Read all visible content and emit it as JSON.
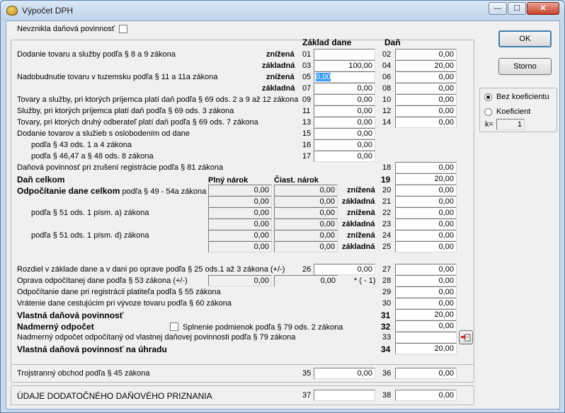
{
  "window": {
    "title": "Výpočet DPH",
    "min": "—",
    "max": "☐",
    "close": "✕"
  },
  "top": {
    "nevznikla": "Nevznikla daňová povinnosť",
    "hdr_zaklad": "Základ dane",
    "hdr_dan": "Daň"
  },
  "buttons": {
    "ok": "OK",
    "storno": "Storno"
  },
  "koef": {
    "bez": "Bez koeficientu",
    "koef": "Koeficient",
    "k_label": "k=",
    "k_value": "1"
  },
  "rows": {
    "r1": "Dodanie tovaru a služby podľa § 8 a 9 zákona",
    "znizena": "znížená",
    "zakladna": "základná",
    "r2": "Nadobudnutie tovaru v tuzemsku podľa § 11 a  11a zákona",
    "r3": "Tovary a služby, pri ktorých príjemca platí daň podľa § 69 ods. 2 a 9 až 12 zákona",
    "r4": "Služby, pri ktorých príjemca platí daň podľa § 69 ods. 3 zákona",
    "r5": "Tovary, pri ktorých druhý odberateľ platí daň podľa § 69 ods. 7 zákona",
    "r6": "Dodanie tovarov a služieb s oslobodením od dane",
    "r6a": "podľa § 43 ods. 1 a 4 zákona",
    "r6b": "podľa § 46,47 a § 48 ods. 8 zákona",
    "r7": "Daňová povinnosť pri zrušení registrácie podľa § 81 zákona",
    "dan_celkom": "Daň celkom",
    "plny": "Plný nárok",
    "ciast": "Čiast. nárok",
    "odp": "Odpočítanie dane celkom",
    "odp_suffix": "podľa § 49 - 54a zákona",
    "p51a": "podľa § 51 ods. 1 písm. a) zákona",
    "p51d": "podľa § 51 ods. 1 písm. d) zákona",
    "rozdiel": "Rozdiel v základe dane a v dani po oprave podľa § 25 ods.1 až 3 zákona (+/-)",
    "oprava": "Oprava odpočítanej dane podľa § 53 zákona (+/-)",
    "minus1": "* ( - 1)",
    "r29": "Odpočítanie dane pri registrácii platiteľa podľa § 55 zákona",
    "r30": "Vrátenie dane cestujúcim pri vývoze tovaru podľa § 60 zákona",
    "vlastna": "Vlastná daňová povinnosť",
    "nadmerny": "Nadmerný odpočet",
    "splnenie": "Splnenie podmienok podľa § 79 ods. 2 zákona",
    "r33": "Nadmerný odpočet odpočítaný od vlastnej daňovej povinnosti podľa § 79 zákona",
    "r34": "Vlastná daňová povinnosť na úhradu",
    "troj": "Trojstranný obchod podľa § 45 zákona",
    "udaje": "ÚDAJE DODATOČNÉHO DAŇOVÉHO PRIZNANIA"
  },
  "nums": [
    "01",
    "02",
    "03",
    "04",
    "05",
    "06",
    "07",
    "08",
    "09",
    "10",
    "11",
    "12",
    "13",
    "14",
    "15",
    "16",
    "17",
    "18",
    "19",
    "20",
    "21",
    "22",
    "23",
    "24",
    "25",
    "26",
    "27",
    "28",
    "29",
    "30",
    "31",
    "32",
    "33",
    "34",
    "35",
    "36",
    "37",
    "38"
  ],
  "values": {
    "z01": "",
    "d02": "0,00",
    "z03": "100,00",
    "d04": "20,00",
    "z05": "0,00",
    "d06": "0,00",
    "z07": "0,00",
    "d08": "0,00",
    "z09": "0,00",
    "d10": "0,00",
    "z11": "0,00",
    "d12": "0,00",
    "z13": "0,00",
    "d14": "0,00",
    "z15": "0,00",
    "z16": "0,00",
    "z17": "0,00",
    "d18": "0,00",
    "d19": "20,00",
    "d20": "0,00",
    "d21": "0,00",
    "d22": "0,00",
    "d23": "0,00",
    "d24": "0,00",
    "d25": "0,00",
    "z26": "0,00",
    "d27": "0,00",
    "d28": "0,00",
    "d29": "0,00",
    "d30": "0,00",
    "d31": "20,00",
    "d32": "0,00",
    "d33": "",
    "d34": "20,00",
    "z35": "0,00",
    "d36": "0,00",
    "z37": "",
    "d38": "0,00",
    "plny": [
      "0,00",
      "0,00",
      "0,00",
      "0,00",
      "0,00",
      "0,00"
    ],
    "ciast": [
      "0,00",
      "0,00",
      "0,00",
      "0,00",
      "0,00",
      "0,00"
    ],
    "opr_plny": "0,00",
    "opr_ciast": "0,00"
  }
}
